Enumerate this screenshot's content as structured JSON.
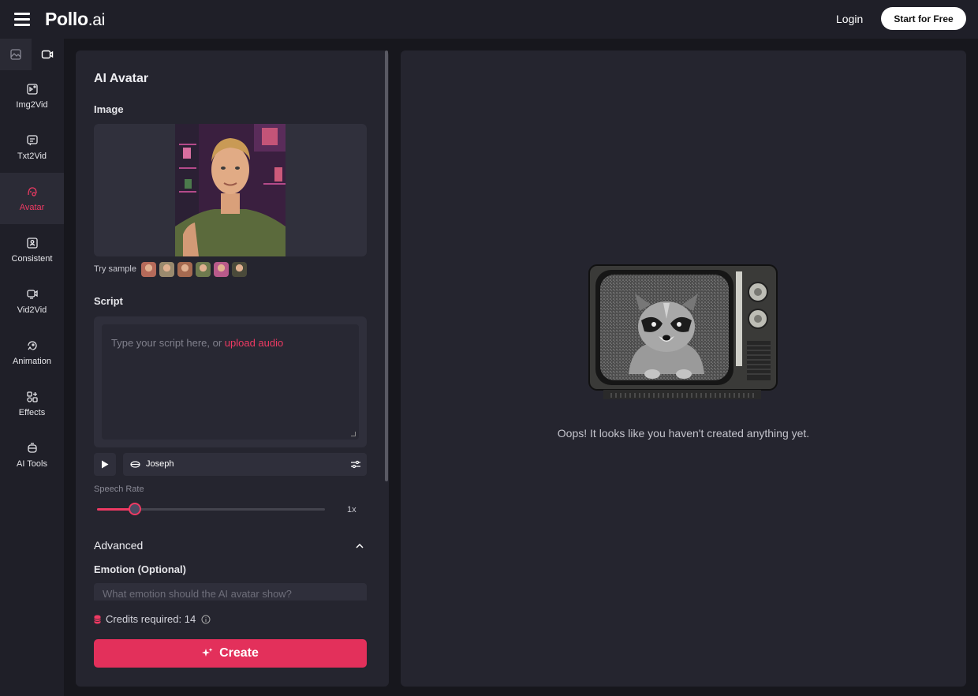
{
  "header": {
    "logo_main": "Pollo",
    "logo_suffix": ".ai",
    "login_label": "Login",
    "start_label": "Start for Free"
  },
  "sidebar": {
    "items": [
      {
        "label": "Img2Vid",
        "icon": "img2vid-icon"
      },
      {
        "label": "Txt2Vid",
        "icon": "txt2vid-icon"
      },
      {
        "label": "Avatar",
        "icon": "avatar-icon",
        "active": true
      },
      {
        "label": "Consistent",
        "icon": "consistent-icon"
      },
      {
        "label": "Vid2Vid",
        "icon": "vid2vid-icon"
      },
      {
        "label": "Animation",
        "icon": "animation-icon"
      },
      {
        "label": "Effects",
        "icon": "effects-icon"
      },
      {
        "label": "AI Tools",
        "icon": "ai-tools-icon"
      }
    ]
  },
  "panel": {
    "title": "AI Avatar",
    "image_label": "Image",
    "try_sample": "Try sample",
    "sample_colors": [
      "#b56a5a",
      "#9a8a6e",
      "#a56a50",
      "#6e7a4e",
      "#b85a8a",
      "#4a4a3a"
    ],
    "script_label": "Script",
    "script_placeholder": "Type your script here, or ",
    "upload_audio": "upload audio",
    "voice_name": "Joseph",
    "speech_rate_label": "Speech Rate",
    "speech_rate_value": "1x",
    "speech_rate_fraction": 0.165,
    "advanced_label": "Advanced",
    "emotion_label": "Emotion (Optional)",
    "emotion_placeholder": "What emotion should the AI avatar show?",
    "credits_label": "Credits required: 14",
    "create_label": "Create"
  },
  "result": {
    "empty_text": "Oops! It looks like you haven't created anything yet."
  },
  "colors": {
    "accent": "#e3305b",
    "bg": "#17171d",
    "panel": "#25252f"
  }
}
